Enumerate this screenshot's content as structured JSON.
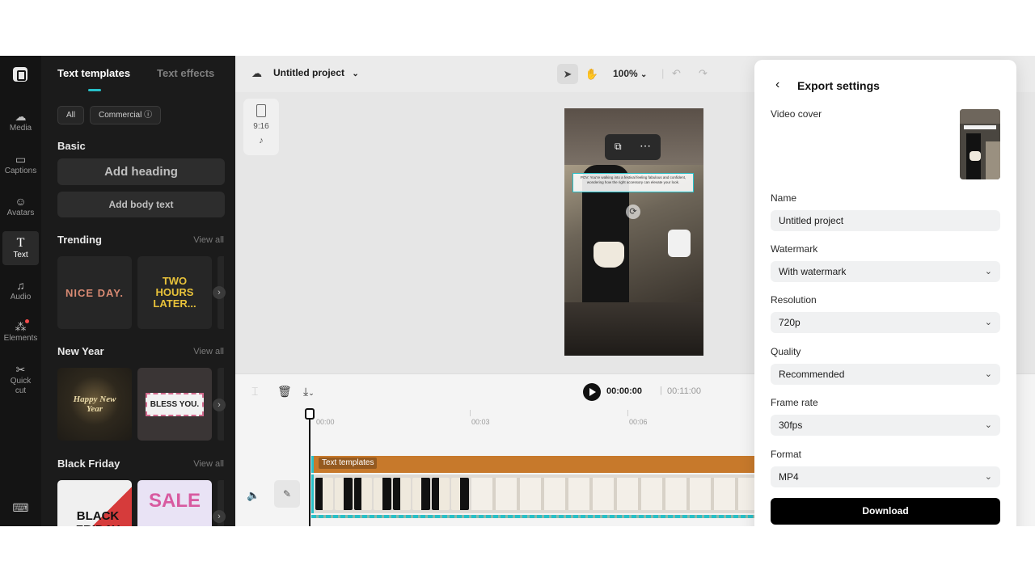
{
  "rail": {
    "items": [
      {
        "label": "Media",
        "icon": "media-cloud-icon"
      },
      {
        "label": "Captions",
        "icon": "captions-icon"
      },
      {
        "label": "Avatars",
        "icon": "avatar-icon"
      },
      {
        "label": "Text",
        "icon": "text-icon"
      },
      {
        "label": "Audio",
        "icon": "music-icon"
      },
      {
        "label": "Elements",
        "icon": "elements-icon"
      },
      {
        "label": "Quick cut",
        "icon": "quick-cut-icon"
      }
    ]
  },
  "panel": {
    "tab_templates": "Text templates",
    "tab_effects": "Text effects",
    "filter_all": "All",
    "filter_commercial": "Commercial ⓘ",
    "basic_title": "Basic",
    "add_heading": "Add heading",
    "add_body_text": "Add body text",
    "view_all": "View all",
    "sections": [
      {
        "title": "Trending",
        "tiles": [
          "NICE DAY.",
          "TWO HOURS LATER..."
        ]
      },
      {
        "title": "New Year",
        "tiles": [
          "Happy New Year",
          "BLESS YOU."
        ]
      },
      {
        "title": "Black Friday",
        "tiles": [
          "BLACK FRIDAY",
          "SALE"
        ]
      }
    ]
  },
  "topbar": {
    "project_name": "Untitled project",
    "zoom": "100%"
  },
  "canvas": {
    "ratio_label": "9:16",
    "overlay_text": "POV: You're walking into a festival feeling fabulous and confident, wondering how the right accessory can elevate your look."
  },
  "timeline": {
    "time_current": "00:00:00",
    "time_separator": "|",
    "time_total": "00:11:00",
    "ticks": [
      "00:00",
      "00:03",
      "00:06"
    ],
    "text_clip_label": "Text templates"
  },
  "export": {
    "title": "Export settings",
    "video_cover_label": "Video cover",
    "name_label": "Name",
    "name_value": "Untitled project",
    "watermark_label": "Watermark",
    "watermark_value": "With watermark",
    "resolution_label": "Resolution",
    "resolution_value": "720p",
    "quality_label": "Quality",
    "quality_value": "Recommended",
    "frame_rate_label": "Frame rate",
    "frame_rate_value": "30fps",
    "format_label": "Format",
    "format_value": "MP4",
    "download_label": "Download"
  },
  "colors": {
    "accent": "#27c0c8",
    "text_clip": "#c7792b",
    "download_button": "#000000"
  }
}
